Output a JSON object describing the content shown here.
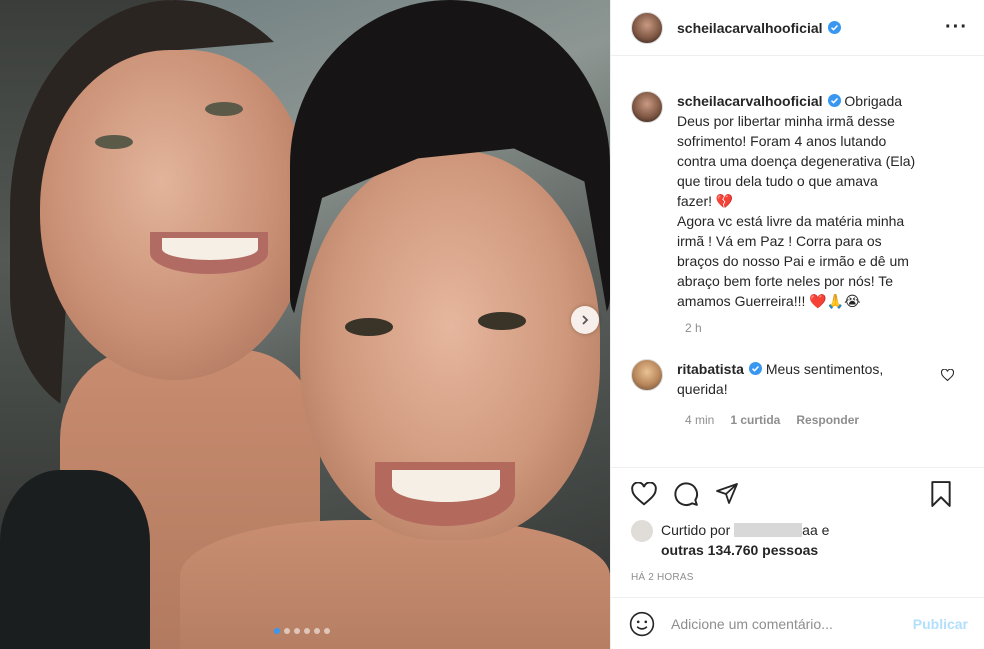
{
  "post": {
    "username": "scheilacarvalhooficial",
    "more_icon": "more-horizontal-icon",
    "photo_description_icon": "photo",
    "carousel": {
      "total": 6,
      "active": 0
    }
  },
  "caption": {
    "username": "scheilacarvalhooficial",
    "lines": [
      "Obrigada",
      "Deus por libertar minha irmã desse",
      "sofrimento! Foram 4 anos lutando",
      "contra uma doença degenerativa (Ela)",
      "que tirou dela tudo o que amava",
      "fazer! 💔",
      "Agora vc está livre da matéria minha",
      "irmã ! Vá em Paz ! Corra para os",
      "braços do nosso Pai e irmão e dê um",
      "abraço bem forte neles por nós! Te",
      "amamos Guerreira!!! ❤️🙏😭"
    ],
    "time": "2 h"
  },
  "comment": {
    "username": "ritabatista",
    "text_line1": "Meus sentimentos,",
    "text_line2": "querida!",
    "time": "4 min",
    "likes": "1 curtida",
    "reply": "Responder"
  },
  "likes": {
    "prefix": "Curtido por",
    "suffix": "aa e",
    "others": "outras 134.760 pessoas",
    "ago": "HÁ 2 HORAS"
  },
  "add_comment": {
    "placeholder": "Adicione um comentário...",
    "publish": "Publicar"
  },
  "colors": {
    "verified": "#3897f0",
    "publish_disabled": "#b2dffc",
    "heart_red": "#ed4956"
  }
}
